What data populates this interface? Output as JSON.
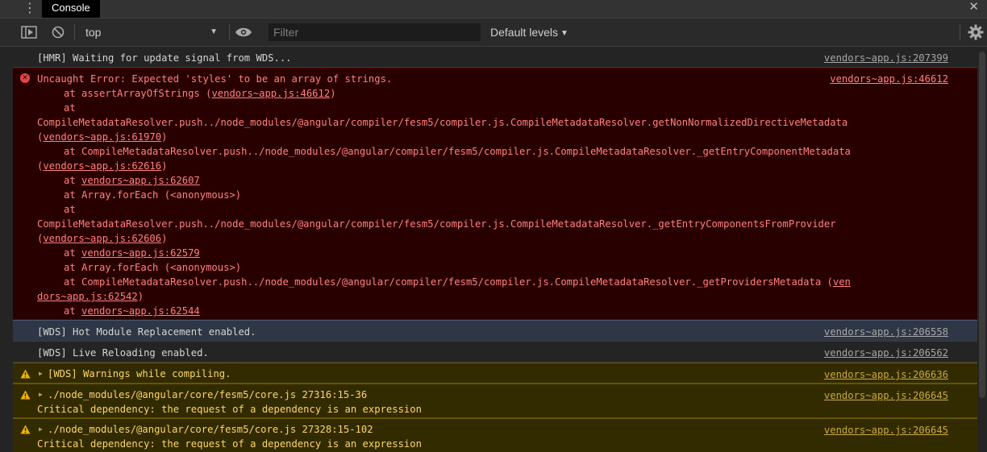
{
  "tabs": {
    "active_label": "Console",
    "menu_icon": "more-vertical-icon",
    "close_icon": "close-icon"
  },
  "toolbar": {
    "context_value": "top",
    "filter_placeholder": "Filter",
    "levels_label": "Default levels",
    "icons": [
      "sidebar-toggle-icon",
      "clear-console-icon",
      "eye-icon",
      "gear-icon"
    ]
  },
  "colors": {
    "error_bg": "#290000",
    "error_text": "#ff8080",
    "warning_bg": "#332b00",
    "warning_text": "#fcd66c",
    "info_text": "#d5d5d5"
  },
  "messages": {
    "hmr": {
      "text": "[HMR] Waiting for update signal from WDS...",
      "source": "vendors~app.js:207399"
    },
    "error": {
      "source": "vendors~app.js:46612",
      "lines": [
        "Uncaught Error: Expected 'styles' to be an array of strings.",
        "at assertArrayOfStrings (",
        "vendors~app.js:46612",
        ")",
        "at",
        "CompileMetadataResolver.push../node_modules/@angular/compiler/fesm5/compiler.js.CompileMetadataResolver.getNonNormalizedDirectiveMetadata",
        "(",
        "vendors~app.js:61970",
        ")",
        "at CompileMetadataResolver.push../node_modules/@angular/compiler/fesm5/compiler.js.CompileMetadataResolver._getEntryComponentMetadata",
        "(",
        "vendors~app.js:62616",
        ")",
        "at ",
        "vendors~app.js:62607",
        "at Array.forEach (<anonymous>)",
        "at",
        "CompileMetadataResolver.push../node_modules/@angular/compiler/fesm5/compiler.js.CompileMetadataResolver._getEntryComponentsFromProvider",
        "(",
        "vendors~app.js:62606",
        ")",
        "at ",
        "vendors~app.js:62579",
        "at Array.forEach (<anonymous>)",
        "at CompileMetadataResolver.push../node_modules/@angular/compiler/fesm5/compiler.js.CompileMetadataResolver._getProvidersMetadata (",
        "ven",
        "dors~app.js:62542",
        ")",
        "at ",
        "vendors~app.js:62544"
      ]
    },
    "hmr_enabled": {
      "text": "[WDS] Hot Module Replacement enabled.",
      "source": "vendors~app.js:206558"
    },
    "live_reload": {
      "text": "[WDS] Live Reloading enabled.",
      "source": "vendors~app.js:206562"
    },
    "warn1": {
      "text": "[WDS] Warnings while compiling.",
      "source": "vendors~app.js:206636"
    },
    "warn2": {
      "text": "./node_modules/@angular/core/fesm5/core.js 27316:15-36",
      "detail": "Critical dependency: the request of a dependency is an expression",
      "source": "vendors~app.js:206645"
    },
    "warn3": {
      "text": "./node_modules/@angular/core/fesm5/core.js 27328:15-102",
      "detail": "Critical dependency: the request of a dependency is an expression",
      "source": "vendors~app.js:206645"
    }
  }
}
